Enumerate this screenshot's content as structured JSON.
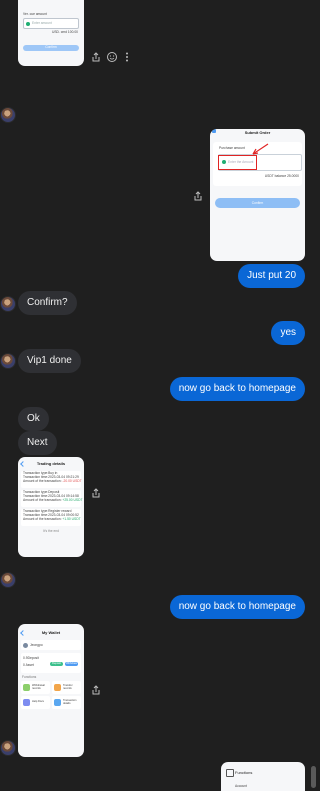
{
  "colors": {
    "background": "#1f1f1f",
    "incoming_bubble": "#2f3034",
    "outgoing_bubble": "#0a67d6",
    "accent_blue": "#4f9bf2",
    "highlight_red": "#e02424"
  },
  "icons": {
    "share": "share-icon",
    "emoji": "smiley-icon",
    "more": "more-vert-icon",
    "back": "back-arrow-icon"
  },
  "messages": [
    {
      "id": "m1",
      "side": "out",
      "text": "Just put 20"
    },
    {
      "id": "m2",
      "side": "in",
      "text": "Confirm?"
    },
    {
      "id": "m3",
      "side": "out",
      "text": "yes"
    },
    {
      "id": "m4",
      "side": "in",
      "text": "Vip1 done"
    },
    {
      "id": "m5",
      "side": "out",
      "text": "now go back to homepage"
    },
    {
      "id": "m6",
      "side": "in",
      "text": "Ok"
    },
    {
      "id": "m7",
      "side": "in",
      "text": "Next"
    },
    {
      "id": "m8",
      "side": "out",
      "text": "now go back to homepage"
    }
  ],
  "screenshots": {
    "top": {
      "label": "Ver. cue amount",
      "placeholder": "Enter amount",
      "note": "USD. cmd 100.00",
      "button": "Confirm"
    },
    "submit": {
      "title": "Submit Order",
      "field_label": "Purchase amount",
      "placeholder": "Enter the Amount",
      "note": "USDT balance 25.0000",
      "button": "Confirm"
    },
    "history": {
      "title": "Trading details",
      "records": [
        {
          "l1": "Transaction type:Buy in",
          "l2": "Transaction time:2023-03-04 09:21:29",
          "l3": "Amount of the transaction:",
          "v": "-20.00 USDT"
        },
        {
          "l1": "Transaction type:Deposit",
          "l2": "Transaction time:2023-03-04 09:14:58",
          "l3": "Amount of the transaction:",
          "v": "+25.00 USDT"
        },
        {
          "l1": "Transaction type:Register reward",
          "l2": "Transaction time:2023-03-04 09:00:52",
          "l3": "Amount of the transaction:",
          "v": "+1.50 USDT"
        }
      ],
      "footer": "It's the end"
    },
    "mywallet": {
      "title": "My Wallet",
      "user": "Jeongpo",
      "balance_label": "0.9Deposit",
      "asset_label": "0 Asset",
      "btn_deposit": "Deposit",
      "btn_withdraw": "Withdraw",
      "section": "Functions",
      "tiles": [
        "Withdrawal records",
        "Transfer records",
        "Help Docs",
        "Transaction details"
      ]
    },
    "bottom": {
      "label": "Functions",
      "item": "Account"
    }
  }
}
